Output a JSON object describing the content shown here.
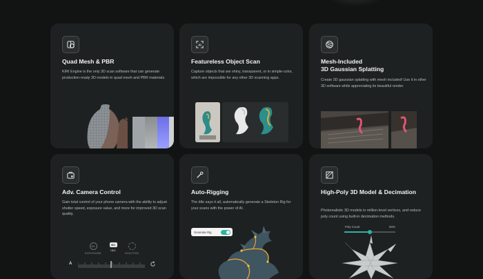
{
  "cards": [
    {
      "title": "Quad Mesh & PBR",
      "description": "KIRI Engine is the only 3D scan software that can generate production-ready 3D models in quad mesh and PBR materials.",
      "icon": "quad-mesh-icon"
    },
    {
      "title": "Featureless Object Scan",
      "description": "Capture objects that are shiny, transparent, or in simple-color, which are impossible for any other 3D scanning apps.",
      "icon": "ai-scan-icon"
    },
    {
      "title_line1": "Mesh-Included",
      "title_line2": "3D Gaussian Splatting",
      "description": "Create 3D gaussian splatting with mesh included! Use it in other 3D software while appreciating its beautiful render.",
      "icon": "gaussian-sphere-icon"
    },
    {
      "title": "Adv. Camera Control",
      "description": "Gain total control of your phone camera with the ability to adjust shutter speed, exposure value, and more for improved 3D scan quality.",
      "icon": "camera-settings-icon",
      "modes": [
        "EXPOSURE",
        "ISO",
        "SHUTTER"
      ],
      "iso_badge": "ISO",
      "ev_badge": "EV",
      "auto_label": "A"
    },
    {
      "title": "Auto-Rigging",
      "description": "The title says it all, automatically generate a Skeleton Rig for your scans with the power of AI.",
      "icon": "rig-bone-icon",
      "toggle_label": "Generate Rig"
    },
    {
      "title": "High-Poly 3D Model & Decimation",
      "description": "Photorealistic 3D models in million-level vertices, and reduce poly count using built-in decimation methods.",
      "icon": "decimation-icon",
      "slider_label": "Poly Count",
      "slider_value": "50%",
      "slider_fraction": 0.5
    }
  ],
  "colors": {
    "background": "#121414",
    "card": "#1e2121",
    "accent": "#2fb3a0"
  }
}
